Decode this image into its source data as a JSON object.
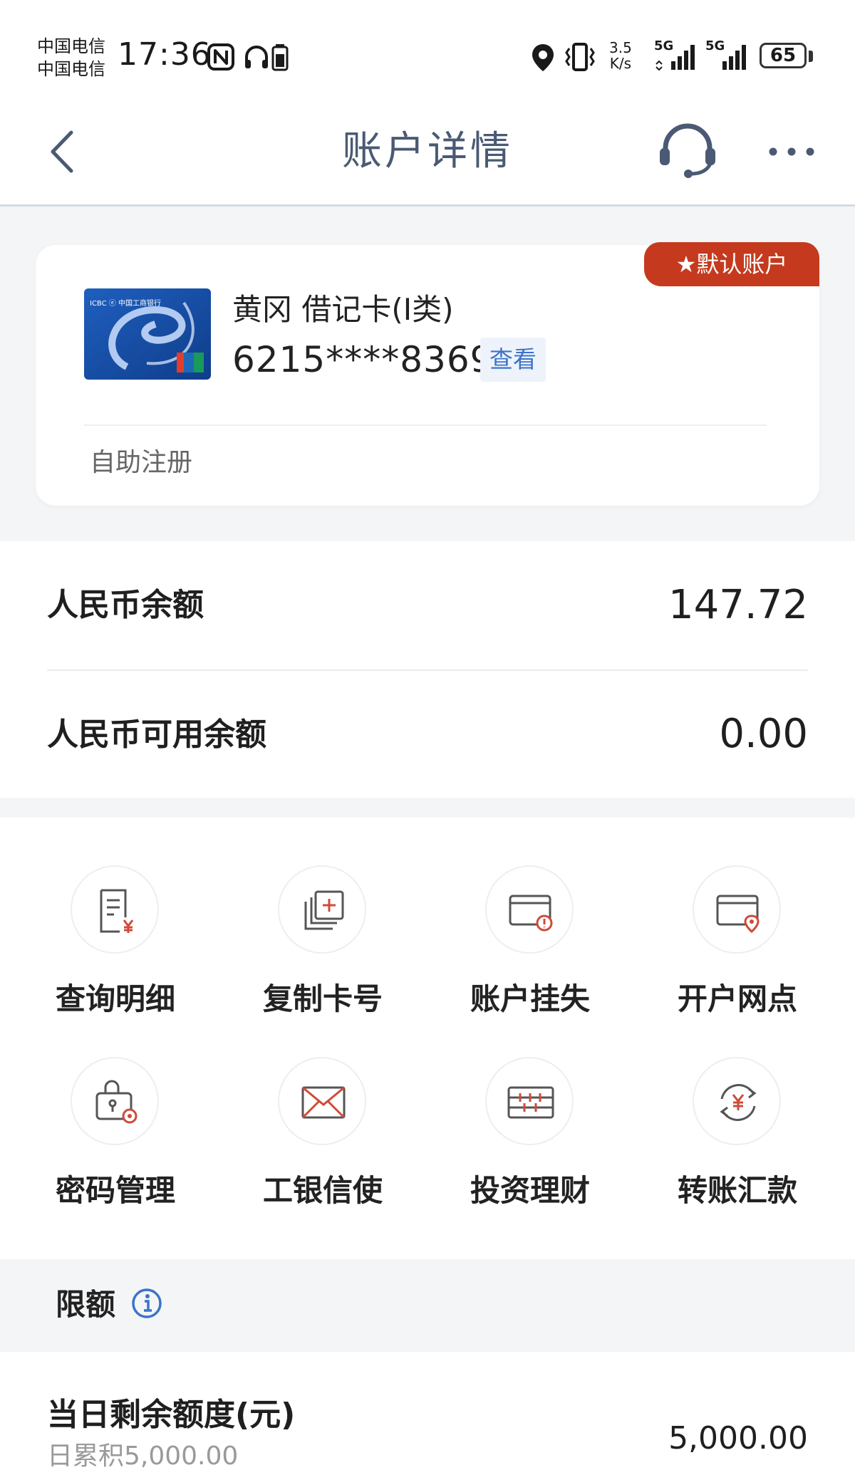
{
  "status_bar": {
    "carrier_1": "中国电信",
    "carrier_2": "中国电信",
    "time": "17:36",
    "net_speed_value": "3.5",
    "net_speed_unit": "K/s",
    "network_1": "5G",
    "network_2": "5G",
    "battery": "65"
  },
  "nav": {
    "title": "账户详情"
  },
  "card": {
    "default_badge": "默认账户",
    "name": "黄冈 借记卡(I类)",
    "number": "6215****8369",
    "view_label": "查看",
    "status": "自助注册",
    "card_logo_text": "ICBC ⓔ 中国工商银行"
  },
  "balances": {
    "rmb_label": "人民币余额",
    "rmb_value": "147.72",
    "available_label": "人民币可用余额",
    "available_value": "0.00"
  },
  "actions": [
    {
      "label": "查询明细",
      "icon": "statement-icon"
    },
    {
      "label": "复制卡号",
      "icon": "copy-icon"
    },
    {
      "label": "账户挂失",
      "icon": "card-alert-icon"
    },
    {
      "label": "开户网点",
      "icon": "card-location-icon"
    },
    {
      "label": "密码管理",
      "icon": "lock-gear-icon"
    },
    {
      "label": "工银信使",
      "icon": "envelope-icon"
    },
    {
      "label": "投资理财",
      "icon": "investment-icon"
    },
    {
      "label": "转账汇款",
      "icon": "transfer-icon"
    }
  ],
  "limits": {
    "title": "限额",
    "daily_label": "当日剩余额度(元)",
    "daily_sub": "日累积5,000.00",
    "daily_value": "5,000.00"
  },
  "colors": {
    "accent_red": "#c53a1e",
    "link_blue": "#3d73c9",
    "title_gray_blue": "#4a5a73",
    "background_gray": "#f4f5f7"
  }
}
